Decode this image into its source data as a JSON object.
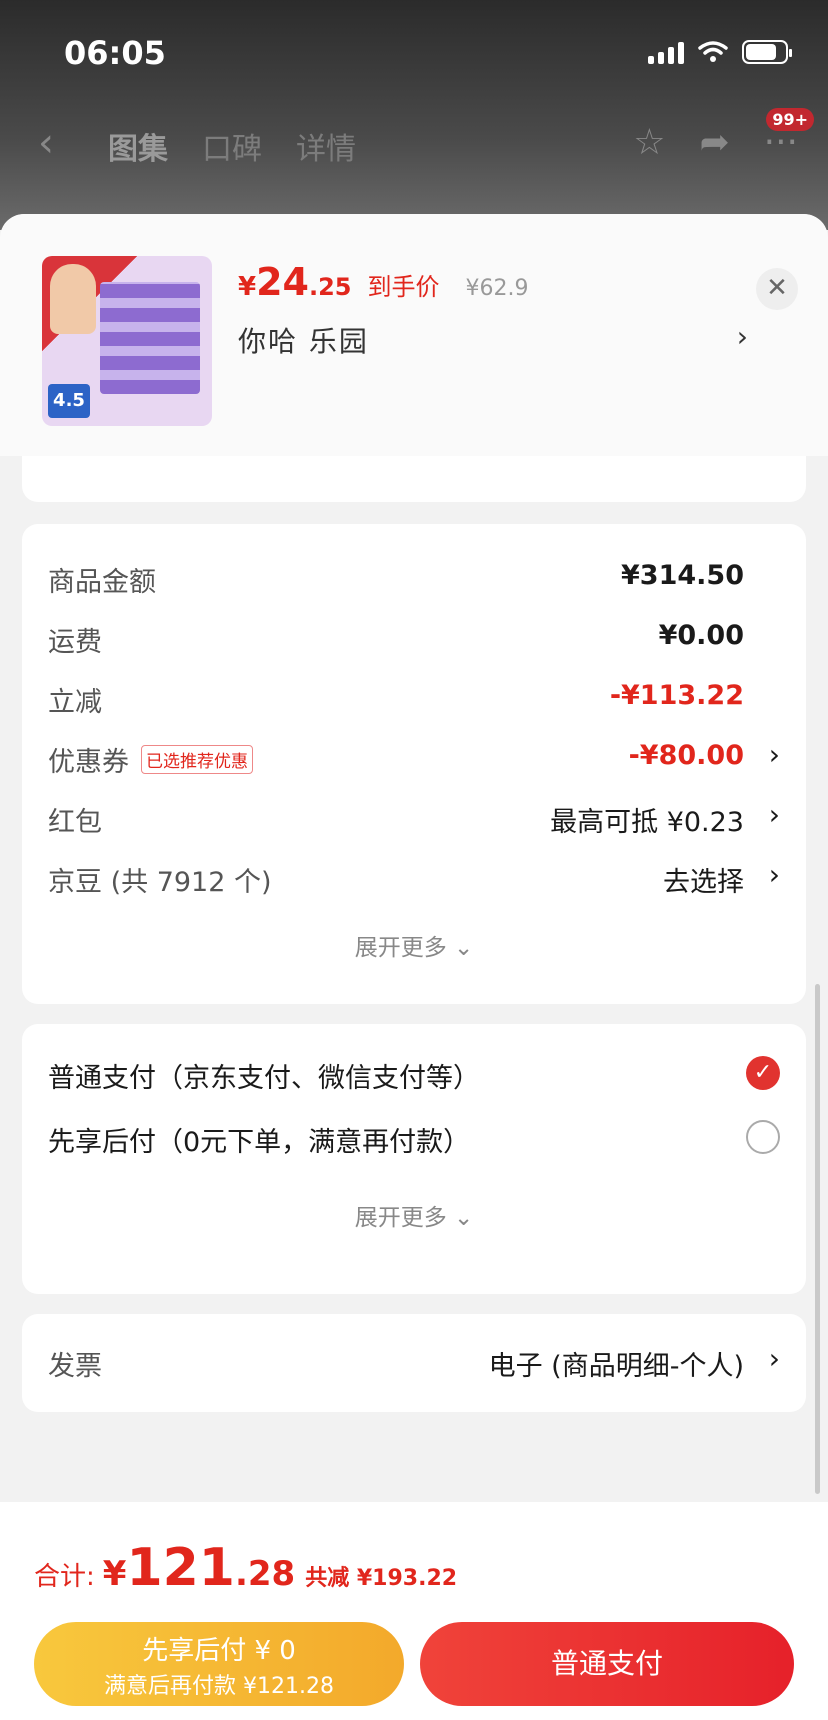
{
  "status": {
    "time": "06:05"
  },
  "nav": {
    "back": "‹",
    "tabs": [
      "图集",
      "口碑",
      "详情"
    ],
    "badge": "99+"
  },
  "product": {
    "price_yen": "¥",
    "price_int": "24",
    "price_dec": ".25",
    "price_tag": "到手价",
    "original_price": "¥62.9",
    "name": "你哈  乐园",
    "thumb_discount": "4.5"
  },
  "amounts": {
    "rows": [
      {
        "label": "商品金额",
        "value": "¥314.50"
      },
      {
        "label": "运费",
        "value": "¥0.00"
      },
      {
        "label": "立减",
        "value": "-¥113.22"
      },
      {
        "label": "优惠券",
        "tag": "已选推荐优惠",
        "value": "-¥80.00"
      },
      {
        "label": "红包",
        "value": "最高可抵 ¥0.23"
      },
      {
        "label": "京豆 (共 7912 个)",
        "value": "去选择"
      }
    ],
    "expand": "展开更多 ⌄"
  },
  "payment": {
    "options": [
      {
        "label": "普通支付（京东支付、微信支付等）",
        "selected": true
      },
      {
        "label": "先享后付（0元下单，满意再付款）",
        "selected": false
      }
    ],
    "expand": "展开更多 ⌄"
  },
  "invoice": {
    "label": "发票",
    "value": "电子 (商品明细-个人)"
  },
  "footer": {
    "total_label": "合计:",
    "total_yen": "¥",
    "total_int": "121",
    "total_dec": ".28",
    "total_saving": "共减 ¥193.22",
    "later_btn_line1": "先享后付 ¥ 0",
    "later_btn_line2": "满意后再付款 ¥121.28",
    "pay_btn": "普通支付"
  },
  "colors": {
    "accent_red": "#e1261c",
    "later_yellow": "#f8c83d"
  }
}
